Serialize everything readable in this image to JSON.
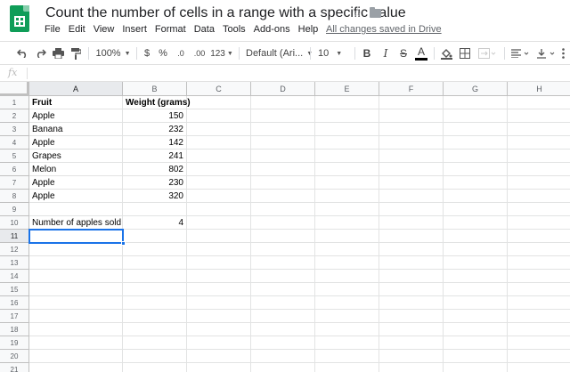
{
  "doc": {
    "title": "Count the number of cells in a range with a specific value",
    "saved_status": "All changes saved in Drive"
  },
  "menu": [
    "File",
    "Edit",
    "View",
    "Insert",
    "Format",
    "Data",
    "Tools",
    "Add-ons",
    "Help"
  ],
  "toolbar": {
    "zoom": "100%",
    "currency": "$",
    "percent": "%",
    "decrease_decimal": ".0",
    "increase_decimal": ".00",
    "more_formats": "123",
    "font": "Default (Ari...",
    "font_size": "10",
    "bold": "B",
    "italic": "I",
    "strikethrough": "S",
    "text_color": "A"
  },
  "formula_bar": {
    "label": "fx",
    "value": ""
  },
  "columns": [
    "A",
    "B",
    "C",
    "D",
    "E",
    "F",
    "G",
    "H"
  ],
  "rows": [
    "1",
    "2",
    "3",
    "4",
    "5",
    "6",
    "7",
    "8",
    "9",
    "10",
    "11",
    "12",
    "13",
    "14",
    "15",
    "16",
    "17",
    "18",
    "19",
    "20",
    "21"
  ],
  "cells": {
    "A1": "Fruit",
    "B1": "Weight (grams)",
    "A2": "Apple",
    "B2": "150",
    "A3": "Banana",
    "B3": "232",
    "A4": "Apple",
    "B4": "142",
    "A5": "Grapes",
    "B5": "241",
    "A6": "Melon",
    "B6": "802",
    "A7": "Apple",
    "B7": "230",
    "A8": "Apple",
    "B8": "320",
    "A10": "Number of apples sold",
    "B10": "4"
  },
  "selected_cell": "A11",
  "colors": {
    "accent": "#1a73e8",
    "sheets_green": "#0f9d58"
  }
}
